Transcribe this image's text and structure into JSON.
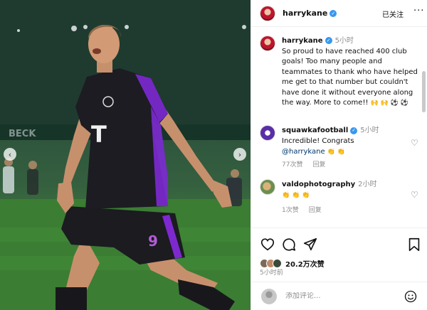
{
  "header": {
    "username": "harrykane",
    "follow_label": "已关注",
    "more": "···"
  },
  "caption": {
    "username": "harrykane",
    "time": "5小时",
    "text": "So proud to have reached 400 club goals! Too many people and teammates to thank who have helped me get to that number but couldn't have done it without everyone along the way. More to come!!",
    "emojis": "🙌 🙌 ⚽ ⚽"
  },
  "comments": [
    {
      "username": "squawkafootball",
      "time": "5小时",
      "text": "Incredible! Congrats",
      "mention": "@harrykane",
      "emojis": "👏 👏",
      "likes": "77次赞",
      "reply": "回复"
    },
    {
      "username": "valdophotography",
      "time": "2小时",
      "text": "",
      "emojis": "👏 👏 👏",
      "likes": "1次赞",
      "reply": "回复"
    }
  ],
  "actions": {
    "likes": "20.2万次赞",
    "posted": "5小时前"
  },
  "add_comment": {
    "placeholder": "添加评论..."
  },
  "photo": {
    "jersey_number": "9",
    "sponsor": "T",
    "banner": "BECK"
  },
  "colors": {
    "verified": "#3897f0",
    "mention": "#00376b",
    "kit": "#1c1c22",
    "kit_accent": "#8a2be2"
  }
}
